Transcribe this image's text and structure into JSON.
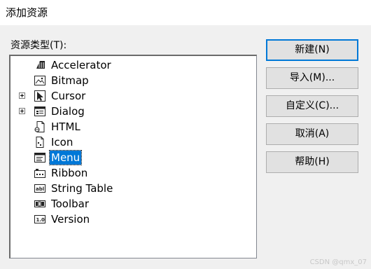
{
  "window": {
    "title": "添加资源"
  },
  "list": {
    "label": "资源类型(T):"
  },
  "tree": [
    {
      "label": "Accelerator",
      "icon": "accelerator-icon",
      "expandable": false,
      "selected": false
    },
    {
      "label": "Bitmap",
      "icon": "bitmap-icon",
      "expandable": false,
      "selected": false
    },
    {
      "label": "Cursor",
      "icon": "cursor-icon",
      "expandable": true,
      "selected": false
    },
    {
      "label": "Dialog",
      "icon": "dialog-icon",
      "expandable": true,
      "selected": false
    },
    {
      "label": "HTML",
      "icon": "html-file-icon",
      "expandable": false,
      "selected": false
    },
    {
      "label": "Icon",
      "icon": "icon-file-icon",
      "expandable": false,
      "selected": false
    },
    {
      "label": "Menu",
      "icon": "menu-icon",
      "expandable": false,
      "selected": true
    },
    {
      "label": "Ribbon",
      "icon": "ribbon-icon",
      "expandable": false,
      "selected": false
    },
    {
      "label": "String Table",
      "icon": "string-table-icon",
      "expandable": false,
      "selected": false
    },
    {
      "label": "Toolbar",
      "icon": "toolbar-icon",
      "expandable": false,
      "selected": false
    },
    {
      "label": "Version",
      "icon": "version-icon",
      "expandable": false,
      "selected": false
    }
  ],
  "buttons": {
    "new": "新建(N)",
    "import": "导入(M)...",
    "custom": "自定义(C)...",
    "cancel": "取消(A)",
    "help": "帮助(H)"
  },
  "watermark": "CSDN @qmx_07",
  "colors": {
    "selection": "#0078d7",
    "default_button_border": "#0078d7"
  }
}
